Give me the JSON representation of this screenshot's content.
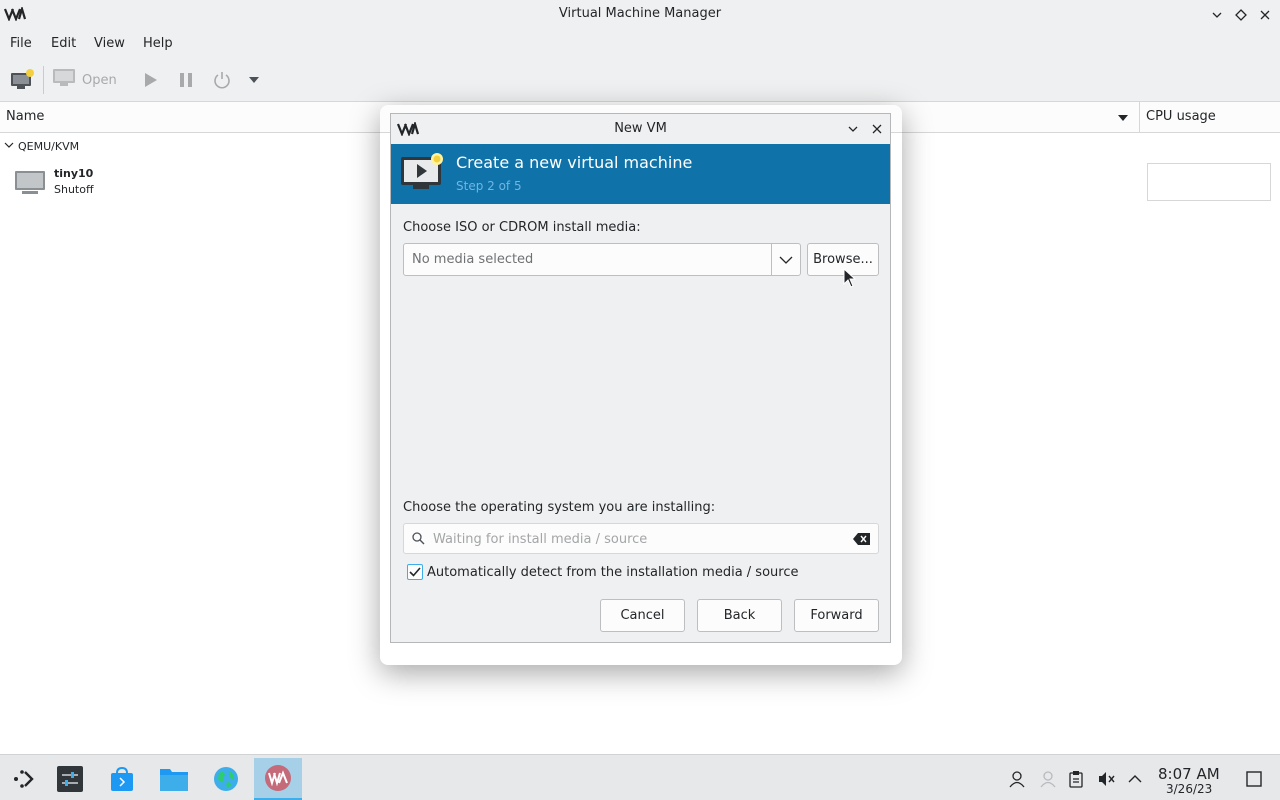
{
  "window": {
    "title": "Virtual Machine Manager"
  },
  "menu": [
    "File",
    "Edit",
    "View",
    "Help"
  ],
  "toolbar": {
    "open_label": "Open"
  },
  "columns": {
    "name": "Name",
    "cpu": "CPU usage"
  },
  "vm_list": {
    "group": "QEMU/KVM",
    "vms": [
      {
        "name": "tiny10",
        "state": "Shutoff"
      }
    ]
  },
  "dialog": {
    "title": "New VM",
    "heading": "Create a new virtual machine",
    "step": "Step 2 of 5",
    "media_label": "Choose ISO or CDROM install media:",
    "media_value": "No media selected",
    "browse_label": "Browse...",
    "os_label": "Choose the operating system you are installing:",
    "os_placeholder": "Waiting for install media / source",
    "auto_detect_label": "Automatically detect from the installation media / source",
    "auto_detect_checked": true,
    "cancel_label": "Cancel",
    "back_label": "Back",
    "forward_label": "Forward"
  },
  "taskbar": {
    "time": "8:07 AM",
    "date": "3/26/23"
  },
  "colors": {
    "banner": "#0f72a8",
    "accent": "#3daee9"
  }
}
